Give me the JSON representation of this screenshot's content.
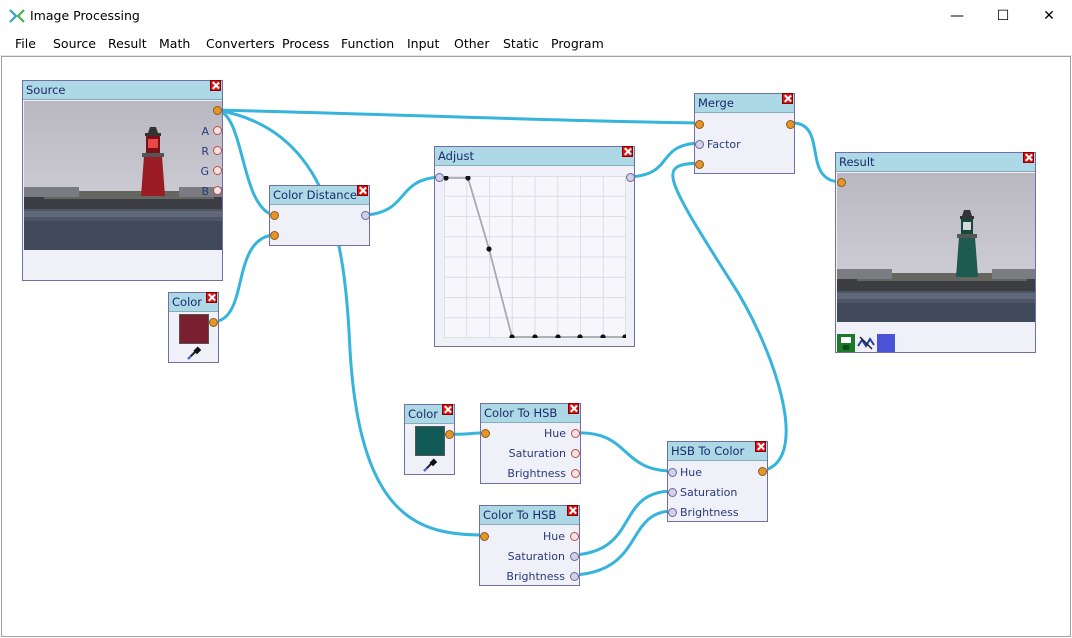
{
  "window": {
    "title": "Image Processing",
    "minimize_glyph": "—",
    "maximize_glyph": "☐",
    "close_glyph": "✕"
  },
  "menu": [
    "File",
    "Source",
    "Result",
    "Math",
    "Converters",
    "Process",
    "Function",
    "Input",
    "Other",
    "Static",
    "Program"
  ],
  "nodes": {
    "source": {
      "title": "Source",
      "ports": [
        "A",
        "R",
        "G",
        "B"
      ]
    },
    "color_distance": {
      "title": "Color Distance"
    },
    "color1": {
      "title": "Color",
      "swatch": "#7a1f2f"
    },
    "adjust": {
      "title": "Adjust"
    },
    "merge": {
      "title": "Merge",
      "ports": [
        "Factor"
      ]
    },
    "result": {
      "title": "Result"
    },
    "color2": {
      "title": "Color",
      "swatch": "#115a55"
    },
    "color_to_hsb_1": {
      "title": "Color To HSB",
      "ports": [
        "Hue",
        "Saturation",
        "Brightness"
      ]
    },
    "color_to_hsb_2": {
      "title": "Color To HSB",
      "ports": [
        "Hue",
        "Saturation",
        "Brightness"
      ]
    },
    "hsb_to_color": {
      "title": "HSB To Color",
      "ports": [
        "Hue",
        "Saturation",
        "Brightness"
      ]
    }
  },
  "colors": {
    "wire": "#36b4dc",
    "node_header": "#add8e6",
    "lighthouse_source": "#9b1b24",
    "lighthouse_result": "#1d5a50"
  },
  "icons": [
    "save-icon",
    "chart-icon",
    "color-icon",
    "eyedropper-icon",
    "close-icon"
  ]
}
